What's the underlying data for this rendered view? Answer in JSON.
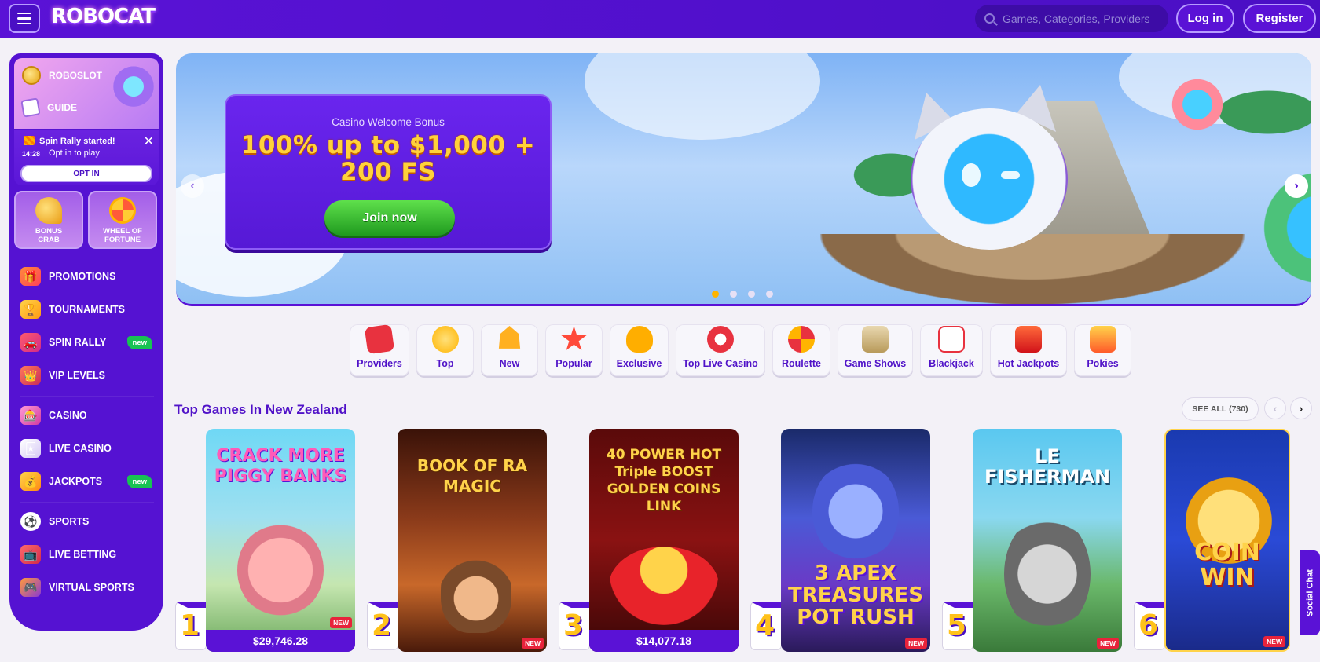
{
  "header": {
    "logo": "ROBOCAT",
    "search_placeholder": "Games, Categories, Providers",
    "login": "Log in",
    "register": "Register"
  },
  "sidebar": {
    "robo": [
      {
        "label": "ROBOSLOT"
      },
      {
        "label": "GUIDE"
      }
    ],
    "rally": {
      "title": "Spin Rally started!",
      "time": "14:28",
      "subtitle": "Opt in to play",
      "button": "OPT IN"
    },
    "tiles": [
      {
        "label1": "BONUS",
        "label2": "CRAB"
      },
      {
        "label1": "WHEEL OF",
        "label2": "FORTUNE"
      }
    ],
    "items": [
      {
        "label": "PROMOTIONS",
        "icon": "gift-icon"
      },
      {
        "label": "TOURNAMENTS",
        "icon": "trophy-icon"
      },
      {
        "label": "SPIN RALLY",
        "icon": "rally-car-icon",
        "badge": "new"
      },
      {
        "label": "VIP LEVELS",
        "icon": "vip-icon"
      },
      {
        "label": "CASINO",
        "icon": "casino-icon"
      },
      {
        "label": "LIVE CASINO",
        "icon": "cards-icon"
      },
      {
        "label": "JACKPOTS",
        "icon": "jackpot-icon",
        "badge": "new"
      },
      {
        "label": "SPORTS",
        "icon": "soccer-ball-icon"
      },
      {
        "label": "LIVE BETTING",
        "icon": "live-betting-icon"
      },
      {
        "label": "VIRTUAL SPORTS",
        "icon": "virtual-sports-icon"
      }
    ]
  },
  "banner": {
    "subtitle": "Casino Welcome Bonus",
    "title": "100% up to $1,000 + 200 FS",
    "cta": "Join now",
    "prev": "‹",
    "next": "›",
    "active_slide": 1,
    "slide_count": 4
  },
  "categories": [
    {
      "label": "Providers",
      "icon": "providers-icon",
      "color": "#e8323f"
    },
    {
      "label": "Top",
      "icon": "top-medal-icon",
      "color": "#ffb400"
    },
    {
      "label": "New",
      "icon": "bell-icon",
      "color": "#ffb020"
    },
    {
      "label": "Popular",
      "icon": "star-icon",
      "color": "#ff4a3a"
    },
    {
      "label": "Exclusive",
      "icon": "diamond-icon",
      "color": "#ffae00"
    },
    {
      "label": "Top Live Casino",
      "icon": "chips-icon",
      "color": "#e8323f"
    },
    {
      "label": "Roulette",
      "icon": "roulette-icon",
      "color": "#ff7a33"
    },
    {
      "label": "Game Shows",
      "icon": "game-shows-icon",
      "color": "#c8a66a"
    },
    {
      "label": "Blackjack",
      "icon": "blackjack-icon",
      "color": "#e8323f"
    },
    {
      "label": "Hot Jackpots",
      "icon": "seven-icon",
      "color": "#ff3a2a"
    },
    {
      "label": "Pokies",
      "icon": "pokies-icon",
      "color": "#ff5a2a"
    }
  ],
  "games_section": {
    "title": "Top Games In New Zealand",
    "see_all": "SEE ALL (730)",
    "prev": "‹",
    "next": "›"
  },
  "games": [
    {
      "rank": "1",
      "title": "CRACK MORE PIGGY BANKS",
      "jackpot": "$29,746.28",
      "badge": "NEW"
    },
    {
      "rank": "2",
      "title": "BOOK OF RA MAGIC",
      "jackpot": "",
      "badge": "NEW"
    },
    {
      "rank": "3",
      "title": "40 POWER HOT Triple BOOST GOLDEN COINS LINK",
      "jackpot": "$14,077.18",
      "badge": ""
    },
    {
      "rank": "4",
      "title": "3 APEX TREASURES POT RUSH",
      "jackpot": "",
      "badge": "NEW"
    },
    {
      "rank": "5",
      "title": "LE FISHERMAN",
      "jackpot": "",
      "badge": "NEW"
    },
    {
      "rank": "6",
      "title": "COIN WIN",
      "jackpot": "",
      "badge": "NEW"
    }
  ],
  "social_chat": "Social Chat"
}
